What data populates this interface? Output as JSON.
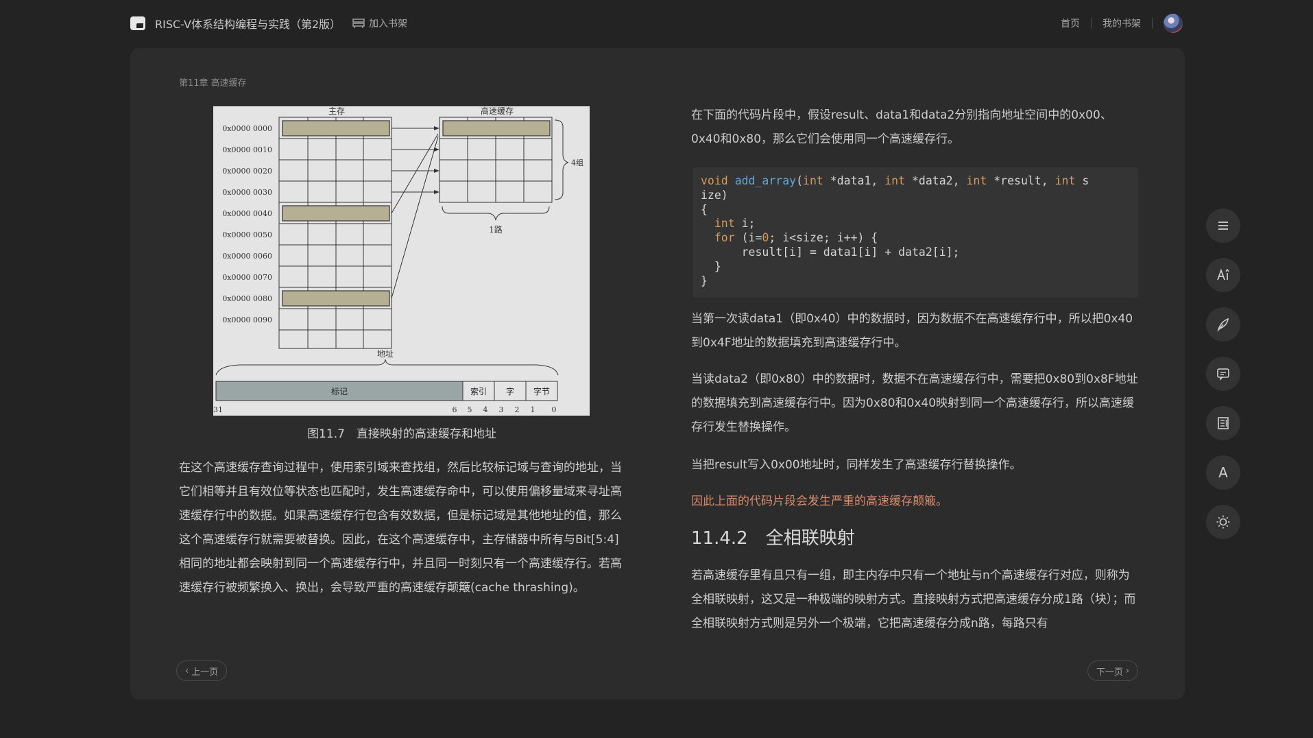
{
  "header": {
    "book_title": "RISC-V体系结构编程与实践（第2版）",
    "add_shelf_label": "加入书架",
    "nav_home": "首页",
    "nav_my_shelf": "我的书架"
  },
  "reader": {
    "chapter_label": "第11章 高速缓存",
    "figure": {
      "main_memory_label": "主存",
      "cache_label": "高速缓存",
      "addresses": [
        "0x0000 0000",
        "0x0000 0010",
        "0x0000 0020",
        "0x0000 0030",
        "0x0000 0040",
        "0x0000 0050",
        "0x0000 0060",
        "0x0000 0070",
        "0x0000 0080",
        "0x0000 0090"
      ],
      "sets_label": "4组",
      "way_label": "1路",
      "address_label": "地址",
      "fields": [
        "标记",
        "索引",
        "字",
        "字节"
      ],
      "bit_labels": [
        "31",
        "6",
        "5",
        "4",
        "3",
        "2",
        "1",
        "0"
      ]
    },
    "figure_caption": "图11.7　直接映射的高速缓存和地址",
    "left_paragraph": "在这个高速缓存查询过程中，使用索引域来查找组，然后比较标记域与查询的地址，当它们相等并且有效位等状态也匹配时，发生高速缓存命中，可以使用偏移量域来寻址高速缓存行中的数据。如果高速缓存行包含有效数据，但是标记域是其他地址的值，那么这个高速缓存行就需要被替换。因此，在这个高速缓存中，主存储器中所有与Bit[5:4]相同的地址都会映射到同一个高速缓存行中，并且同一时刻只有一个高速缓存行。若高速缓存行被频繁换入、换出，会导致严重的高速缓存颠簸(cache thrashing)。",
    "right_p1": "在下面的代码片段中，假设result、data1和data2分别指向地址空间中的0x00、0x40和0x80，那么它们会使用同一个高速缓存行。",
    "code": {
      "void": "void",
      "fn_name": "add_array",
      "kw_int": "int",
      "kw_for": "for",
      "zero": "0",
      "p_data1": " *data1, ",
      "p_data2": " *data2, ",
      "p_result": " *result, ",
      "p_s": " s",
      "l_size": "ize)",
      "l_open": "{",
      "l_i": " i;",
      "l_for_open": " (i=",
      "l_for_rest": "; i<size; i++) {",
      "l_body": "      result[i] = data1[i] + data2[i];",
      "l_inner_close": "  }",
      "l_close": "}"
    },
    "right_p2": "当第一次读data1（即0x40）中的数据时，因为数据不在高速缓存行中，所以把0x40到0x4F地址的数据填充到高速缓存行中。",
    "right_p3": "当读data2（即0x80）中的数据时，数据不在高速缓存行中，需要把0x80到0x8F地址的数据填充到高速缓存行中。因为0x80和0x40映射到同一个高速缓存行，所以高速缓存行发生替换操作。",
    "right_p4": "当把result写入0x00地址时，同样发生了高速缓存行替换操作。",
    "right_p5": "因此上面的代码片段会发生严重的高速缓存颠簸。",
    "section_heading": "11.4.2　全相联映射",
    "right_p6": "若高速缓存里有且只有一组，即主内存中只有一个地址与n个高速缓存行对应，则称为全相联映射，这又是一种极端的映射方式。直接映射方式把高速缓存分成1路（块）；而全相联映射方式则是另外一个极端，它把高速缓存分成n路，每路只有",
    "prev_page": "上一页",
    "next_page": "下一页"
  },
  "toolbar": {
    "icons": [
      "menu-icon",
      "font-size-icon",
      "pen-icon",
      "comment-icon",
      "notes-icon",
      "font-icon",
      "brightness-icon"
    ],
    "font_glyph": "A"
  }
}
